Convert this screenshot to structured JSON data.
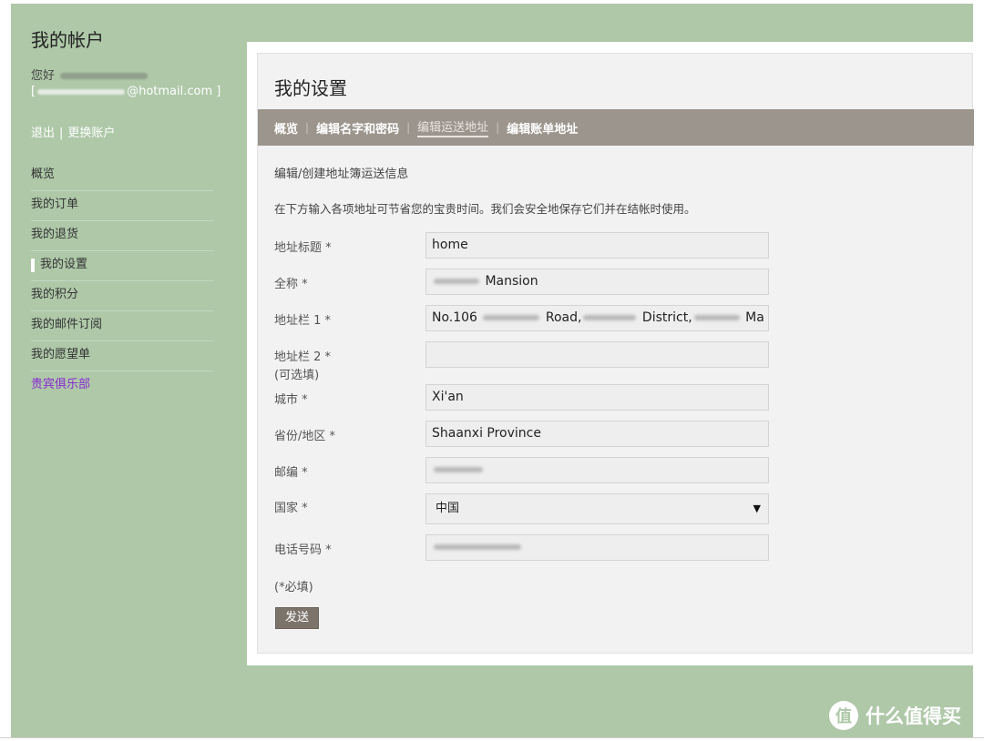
{
  "sidebar": {
    "title": "我的帐户",
    "greeting": "您好",
    "email_prefix": "[",
    "email_domain": "@hotmail.com ]",
    "logout": "退出",
    "link_separator": "|",
    "switch_account": "更换账户",
    "items": [
      {
        "label": "概览"
      },
      {
        "label": "我的订单"
      },
      {
        "label": "我的退货"
      },
      {
        "label": "我的设置"
      },
      {
        "label": "我的积分"
      },
      {
        "label": "我的邮件订阅"
      },
      {
        "label": "我的愿望单"
      },
      {
        "label": "贵宾俱乐部"
      }
    ]
  },
  "main": {
    "title": "我的设置",
    "tabs": [
      {
        "label": "概览"
      },
      {
        "label": "编辑名字和密码"
      },
      {
        "label": "编辑运送地址"
      },
      {
        "label": "编辑账单地址"
      }
    ],
    "tab_separator": "|",
    "section_title": "编辑/创建地址簿运送信息",
    "intro": "在下方输入各项地址可节省您的宝贵时间。我们会安全地保存它们并在结帐时使用。",
    "form": {
      "address_title_label": "地址标题 *",
      "address_title_value": "home",
      "fullname_label": "全称 *",
      "fullname_value": "Mansion",
      "address1_label": "地址栏 1 *",
      "address1_part1": "No.106",
      "address1_part2": "Road,",
      "address1_part3": "District,",
      "address1_part4": "Ma",
      "address2_label": "地址栏 2 *",
      "address2_hint": "(可选填)",
      "address2_value": "",
      "city_label": "城市 *",
      "city_value": "Xi'an",
      "province_label": "省份/地区 *",
      "province_value": "Shaanxi Province",
      "zip_label": "邮编 *",
      "country_label": "国家 *",
      "country_value": "中国",
      "phone_label": "电话号码 *",
      "required_note": "(*必填)",
      "submit_label": "发送"
    }
  },
  "watermark": {
    "icon_text": "值",
    "text": "什么值得买"
  }
}
